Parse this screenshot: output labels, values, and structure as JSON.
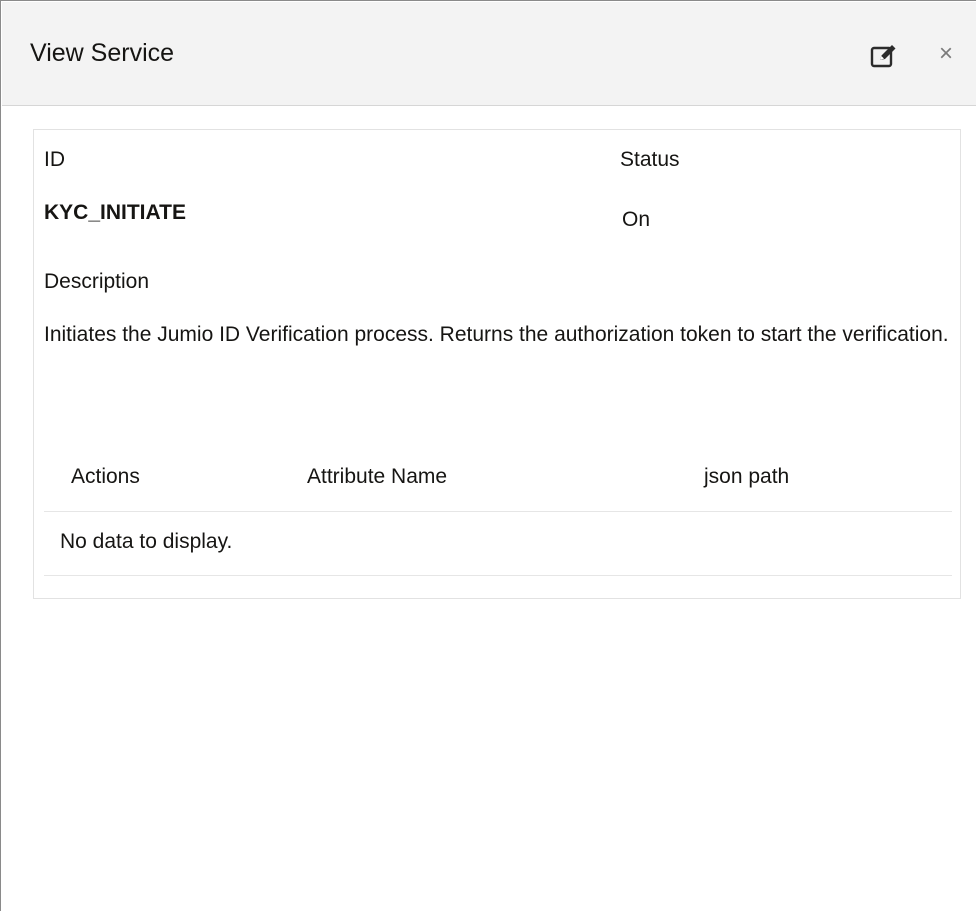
{
  "dialog": {
    "title": "View Service",
    "edit_icon": "edit-icon",
    "close_label": "×"
  },
  "fields": {
    "id_label": "ID",
    "id_value": "KYC_INITIATE",
    "status_label": "Status",
    "status_value": "On",
    "description_label": "Description",
    "description_value": "Initiates the Jumio ID Verification process. Returns the authorization token to start the verification."
  },
  "table": {
    "columns": [
      "Actions",
      "Attribute Name",
      "json path"
    ],
    "empty_message": "No data to display."
  }
}
